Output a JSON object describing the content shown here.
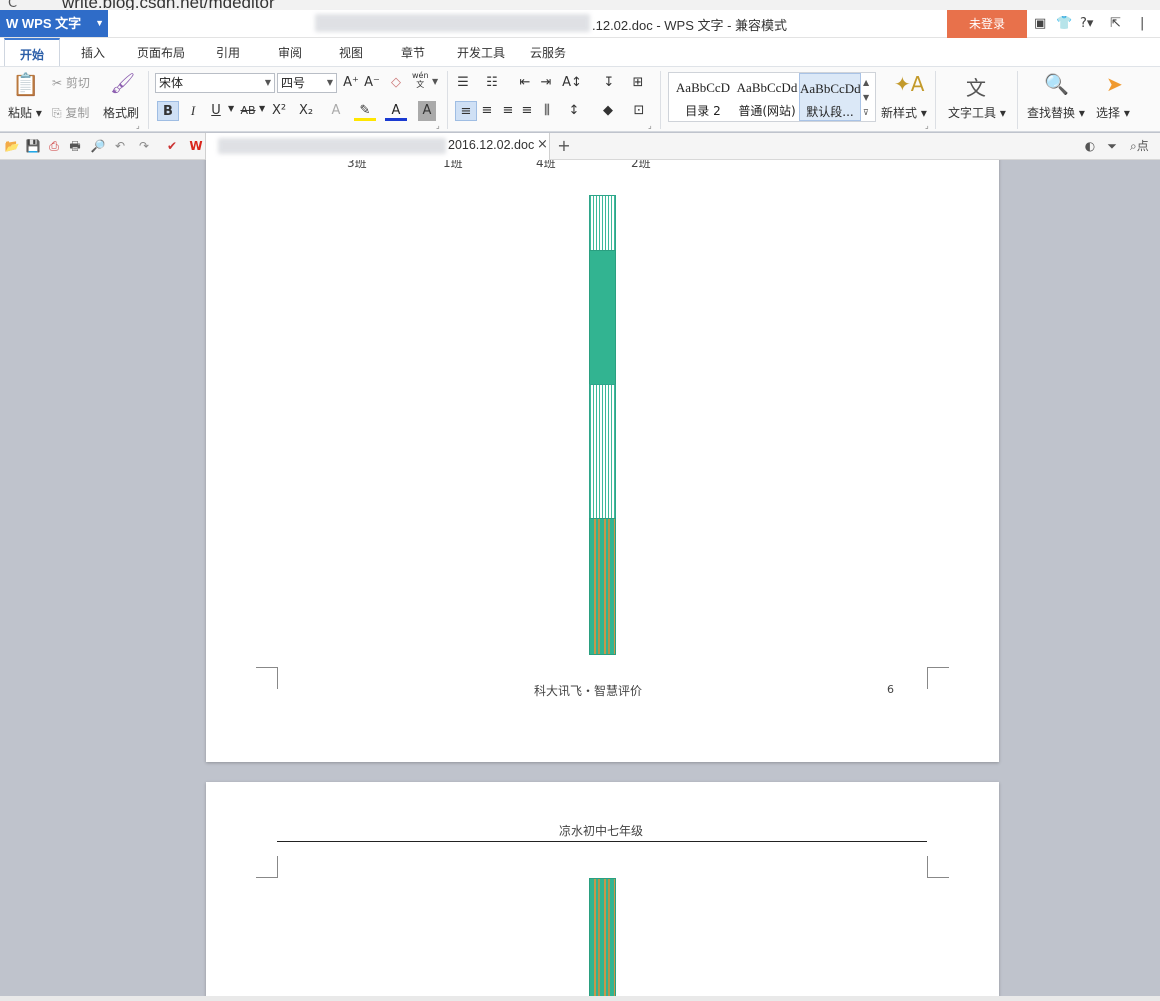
{
  "browser": {
    "url": "write.blog.csdn.net/mdeditor"
  },
  "titlebar": {
    "app_label": "WPS 文字",
    "doc_title": ".12.02.doc - WPS 文字 - 兼容模式",
    "login_label": "未登录",
    "help_label": "?"
  },
  "tabs": [
    "开始",
    "插入",
    "页面布局",
    "引用",
    "审阅",
    "视图",
    "章节",
    "开发工具",
    "云服务"
  ],
  "ribbon": {
    "paste": "粘贴",
    "cut": "剪切",
    "copy": "复制",
    "format_painter": "格式刷",
    "font_name": "宋体",
    "font_size": "四号",
    "bold": "B",
    "italic": "I",
    "underline": "U",
    "strike": "AB",
    "superscript": "X²",
    "subscript": "X₂",
    "pinyin_top": "wén",
    "pinyin_bottom": "文",
    "styles": [
      {
        "sample": "AaBbCcD",
        "name": "目录 2"
      },
      {
        "sample": "AaBbCcDd",
        "name": "普通(网站)"
      },
      {
        "sample": "AaBbCcDd",
        "name": "默认段..."
      }
    ],
    "new_style": "新样式",
    "text_tools": "文字工具",
    "find_replace": "查找替换",
    "select": "选择"
  },
  "quickbar": {
    "doc_tab_name": "2016.12.02.doc",
    "close": "×",
    "add": "+",
    "search_label": "点"
  },
  "page1": {
    "categories": [
      "3班",
      "1班",
      "4班",
      "2班"
    ],
    "footer_text": "科大讯飞・智慧评价",
    "page_number": "6"
  },
  "page2": {
    "header_text": "凉水初中七年级"
  },
  "colors": {
    "accent": "#2f6cc8",
    "login": "#e8714b",
    "bar_green": "#32b491",
    "bar_orange": "#c8964a"
  }
}
